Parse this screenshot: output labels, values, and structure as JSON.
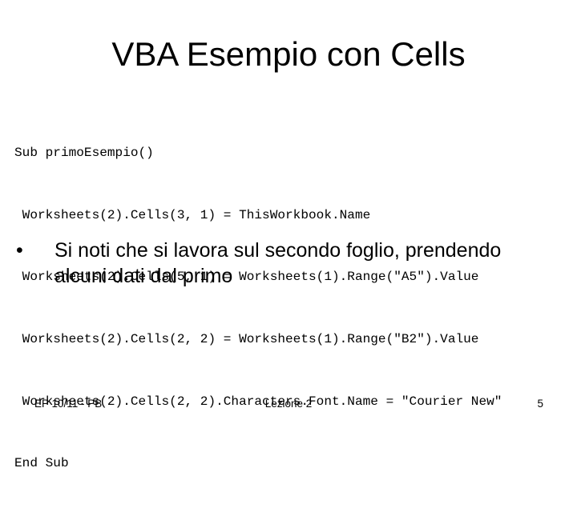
{
  "slide": {
    "title": "VBA Esempio con Cells",
    "code_lines": [
      "Sub primoEsempio()",
      " Worksheets(2).Cells(3, 1) = ThisWorkbook.Name",
      " Worksheets(2).Cells(5, 1) = Worksheets(1).Range(\"A5\").Value",
      " Worksheets(2).Cells(2, 2) = Worksheets(1).Range(\"B2\").Value",
      " Worksheets(2).Cells(2, 2).Characters.Font.Name = \"Courier New\"",
      "End Sub"
    ],
    "bullets": [
      {
        "marker": "•",
        "text": "Si noti che si lavora sul secondo foglio, prendendo alcuni dati dal primo"
      }
    ],
    "footer": {
      "left": "EP 10/11 - PB",
      "center": "Lezione 2",
      "right": "5"
    }
  }
}
